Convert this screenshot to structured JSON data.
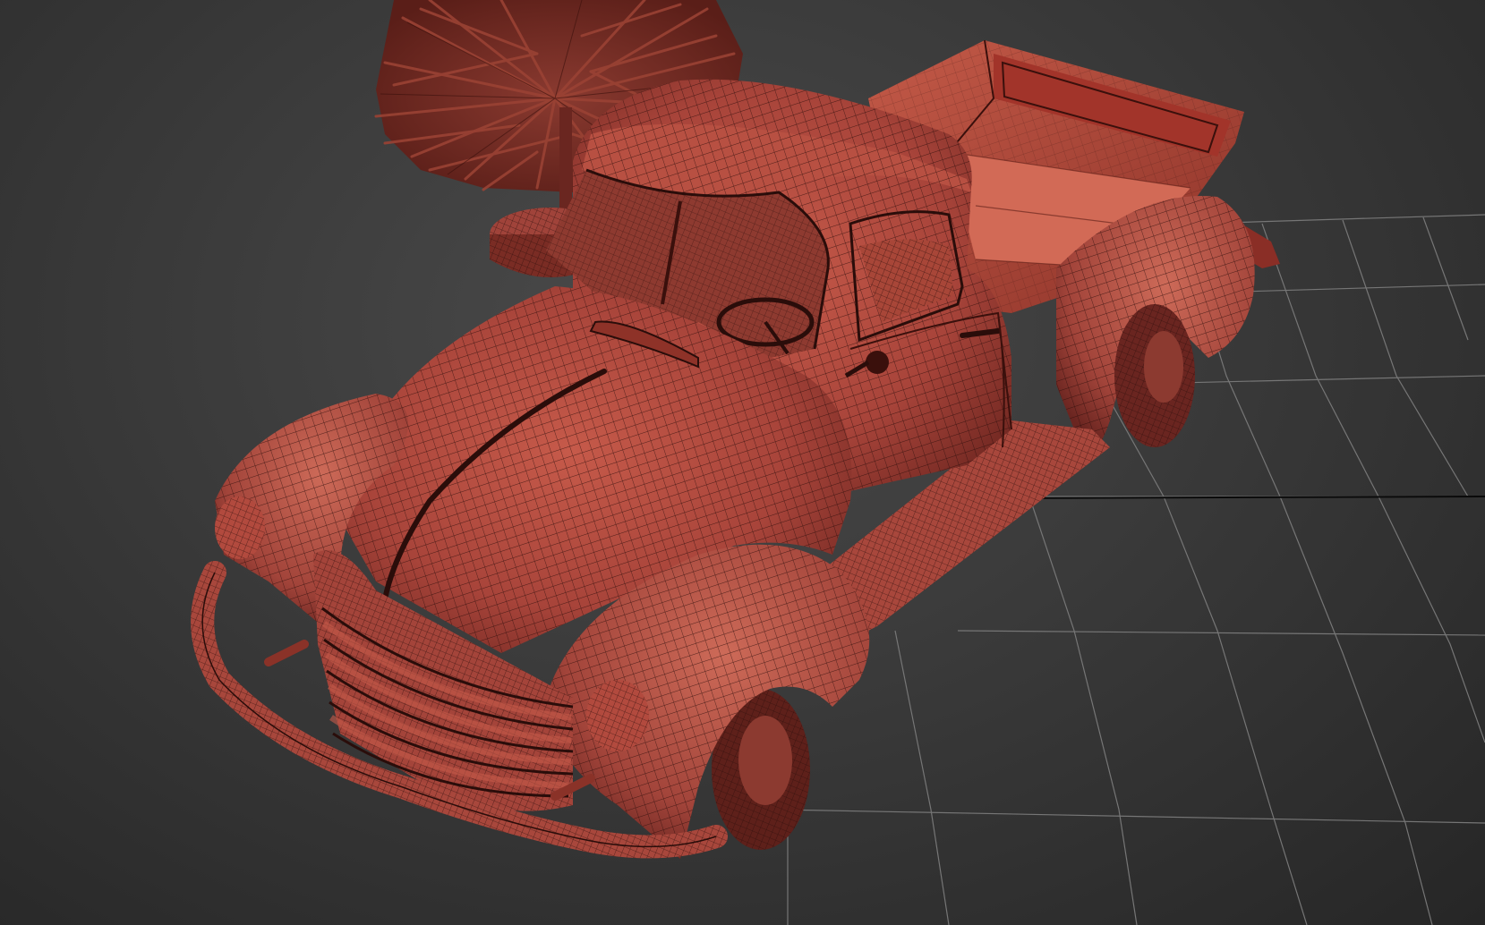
{
  "viewport": {
    "background_color": "#3c3c3c",
    "grid_color": "#7a7a7a",
    "grid_highlight_color": "#0a0a0a"
  },
  "model": {
    "surface_color": "#b2483c",
    "surface_shadow_color": "#7a2a22",
    "surface_highlight_color": "#d8705f",
    "wire_color": "#2a0d0a",
    "display_mode": "edged-faces-wireframe"
  }
}
